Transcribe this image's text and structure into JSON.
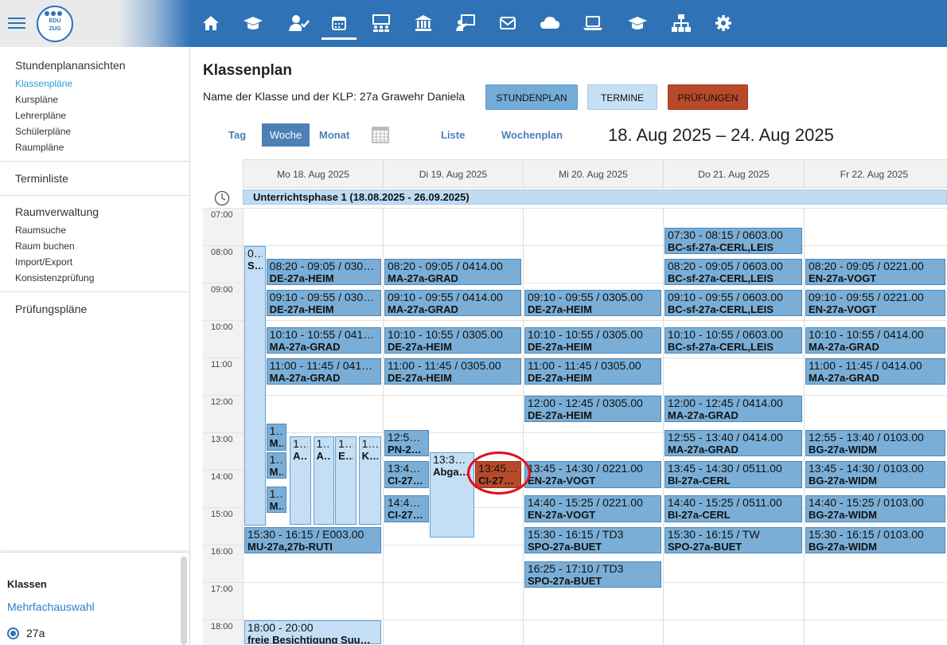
{
  "brand": {
    "logo_line1": "EDU",
    "logo_line2": "ZUG"
  },
  "nav": {
    "icons": [
      "home-icon",
      "graduation-cap-icon",
      "user-check-icon",
      "calendar-icon",
      "people-board-icon",
      "institution-icon",
      "teacher-board-icon",
      "envelope-icon",
      "cloud-icon",
      "laptop-icon",
      "graduation-cap-icon",
      "sitemap-icon",
      "gear-icon"
    ],
    "active": "calendar-icon"
  },
  "sidebar": {
    "section1_title": "Stundenplanansichten",
    "section1_items": [
      "Klassenpläne",
      "Kurspläne",
      "Lehrerpläne",
      "Schülerpläne",
      "Raumpläne"
    ],
    "section2_title": "Terminliste",
    "section3_title": "Raumverwaltung",
    "section3_items": [
      "Raumsuche",
      "Raum buchen",
      "Import/Export",
      "Konsistenzprüfung"
    ],
    "section4_title": "Prüfungspläne",
    "klassen_title": "Klassen",
    "mehrfach": "Mehrfachauswahl",
    "class_option": "27a"
  },
  "header": {
    "title": "Klassenplan",
    "class_line": "Name der Klasse und der KLP: 27a Grawehr Daniela",
    "btn_stundenplan": "STUNDENPLAN",
    "btn_termine": "TERMINE",
    "btn_pruefungen": "PRÜFUNGEN"
  },
  "views": {
    "tag": "Tag",
    "woche": "Woche",
    "monat": "Monat",
    "liste": "Liste",
    "wochenplan": "Wochenplan"
  },
  "date_range": "18. Aug 2025 – 24. Aug 2025",
  "days": [
    "Mo 18. Aug 2025",
    "Di 19. Aug 2025",
    "Mi 20. Aug 2025",
    "Do 21. Aug 2025",
    "Fr 22. Aug 2025"
  ],
  "phase": "Unterrichtsphase 1 (18.08.2025 - 26.09.2025)",
  "times": [
    "07:00",
    "08:00",
    "09:00",
    "10:00",
    "11:00",
    "12:00",
    "13:00",
    "14:00",
    "15:00",
    "16:00",
    "17:00",
    "18:00"
  ],
  "events": [
    {
      "day": 0,
      "start": "08:00",
      "end": "15:30",
      "sub": 0,
      "subw": 0.16,
      "style": "light",
      "t1": "0…",
      "t2": "Sch"
    },
    {
      "day": 0,
      "start": "08:20",
      "end": "09:05",
      "sub": 0.16,
      "subw": 0.84,
      "style": "",
      "t1": "08:20 - 09:05 / 030…",
      "t2": "DE-27a-HEIM"
    },
    {
      "day": 0,
      "start": "09:10",
      "end": "09:55",
      "sub": 0.16,
      "subw": 0.84,
      "style": "",
      "t1": "09:10 - 09:55 / 030…",
      "t2": "DE-27a-HEIM"
    },
    {
      "day": 0,
      "start": "10:10",
      "end": "10:55",
      "sub": 0.16,
      "subw": 0.84,
      "style": "",
      "t1": "10:10 - 10:55 / 041…",
      "t2": "MA-27a-GRAD"
    },
    {
      "day": 0,
      "start": "11:00",
      "end": "11:45",
      "sub": 0.16,
      "subw": 0.84,
      "style": "",
      "t1": "11:00 - 11:45 / 0414…",
      "t2": "MA-27a-GRAD"
    },
    {
      "day": 0,
      "start": "12:45",
      "end": "13:30",
      "sub": 0.16,
      "subw": 0.15,
      "style": "",
      "t1": "1…",
      "t2": "MU"
    },
    {
      "day": 0,
      "start": "13:30",
      "end": "14:15",
      "sub": 0.16,
      "subw": 0.15,
      "style": "",
      "t1": "1…",
      "t2": "MU"
    },
    {
      "day": 0,
      "start": "14:25",
      "end": "15:10",
      "sub": 0.16,
      "subw": 0.15,
      "style": "",
      "t1": "1…",
      "t2": "MU"
    },
    {
      "day": 0,
      "start": "13:05",
      "end": "15:30",
      "sub": 0.33,
      "subw": 0.16,
      "style": "light",
      "t1": "1…",
      "t2": "Abg"
    },
    {
      "day": 0,
      "start": "13:05",
      "end": "15:30",
      "sub": 0.5,
      "subw": 0.16,
      "style": "light",
      "t1": "1…",
      "t2": "Abg"
    },
    {
      "day": 0,
      "start": "13:05",
      "end": "15:30",
      "sub": 0.66,
      "subw": 0.16,
      "style": "light",
      "t1": "1…",
      "t2": "Ein"
    },
    {
      "day": 0,
      "start": "13:05",
      "end": "15:30",
      "sub": 0.83,
      "subw": 0.17,
      "style": "light",
      "t1": "1…",
      "t2": "Kor"
    },
    {
      "day": 0,
      "start": "15:30",
      "end": "16:15",
      "sub": 0,
      "subw": 1,
      "style": "",
      "t1": "15:30 - 16:15 / E003.00",
      "t2": "MU-27a,27b-RUTI"
    },
    {
      "day": 0,
      "start": "18:00",
      "end": "20:00",
      "sub": 0,
      "subw": 1,
      "style": "light",
      "t1": "18:00 - 20:00",
      "t2": "freie Besichtigung Suu…"
    },
    {
      "day": 1,
      "start": "08:20",
      "end": "09:05",
      "sub": 0,
      "subw": 1,
      "style": "",
      "t1": "08:20 - 09:05 / 0414.00",
      "t2": "MA-27a-GRAD"
    },
    {
      "day": 1,
      "start": "09:10",
      "end": "09:55",
      "sub": 0,
      "subw": 1,
      "style": "",
      "t1": "09:10 - 09:55 / 0414.00",
      "t2": "MA-27a-GRAD"
    },
    {
      "day": 1,
      "start": "10:10",
      "end": "10:55",
      "sub": 0,
      "subw": 1,
      "style": "",
      "t1": "10:10 - 10:55 / 0305.00",
      "t2": "DE-27a-HEIM"
    },
    {
      "day": 1,
      "start": "11:00",
      "end": "11:45",
      "sub": 0,
      "subw": 1,
      "style": "",
      "t1": "11:00 - 11:45 / 0305.00",
      "t2": "DE-27a-HEIM"
    },
    {
      "day": 1,
      "start": "12:55",
      "end": "13:40",
      "sub": 0,
      "subw": 0.33,
      "style": "",
      "t1": "12:55…",
      "t2": "PN-2…"
    },
    {
      "day": 1,
      "start": "13:45",
      "end": "14:30",
      "sub": 0,
      "subw": 0.33,
      "style": "",
      "t1": "13:45…",
      "t2": "CI-27…"
    },
    {
      "day": 1,
      "start": "14:40",
      "end": "15:25",
      "sub": 0,
      "subw": 0.33,
      "style": "",
      "t1": "14:40…",
      "t2": "CI-27…"
    },
    {
      "day": 1,
      "start": "13:30",
      "end": "15:50",
      "sub": 0.33,
      "subw": 0.33,
      "style": "light",
      "t1": "13:30…",
      "t2": "Abga…"
    },
    {
      "day": 1,
      "start": "13:45",
      "end": "14:30",
      "sub": 0.66,
      "subw": 0.34,
      "style": "red",
      "t1": "13:45…",
      "t2": "CI-27…"
    },
    {
      "day": 2,
      "start": "09:10",
      "end": "09:55",
      "sub": 0,
      "subw": 1,
      "style": "",
      "t1": "09:10 - 09:55 / 0305.00",
      "t2": "DE-27a-HEIM"
    },
    {
      "day": 2,
      "start": "10:10",
      "end": "10:55",
      "sub": 0,
      "subw": 1,
      "style": "",
      "t1": "10:10 - 10:55 / 0305.00",
      "t2": "DE-27a-HEIM"
    },
    {
      "day": 2,
      "start": "11:00",
      "end": "11:45",
      "sub": 0,
      "subw": 1,
      "style": "",
      "t1": "11:00 - 11:45 / 0305.00",
      "t2": "DE-27a-HEIM"
    },
    {
      "day": 2,
      "start": "12:00",
      "end": "12:45",
      "sub": 0,
      "subw": 1,
      "style": "",
      "t1": "12:00 - 12:45 / 0305.00",
      "t2": "DE-27a-HEIM"
    },
    {
      "day": 2,
      "start": "13:45",
      "end": "14:30",
      "sub": 0,
      "subw": 1,
      "style": "",
      "t1": "13:45 - 14:30 / 0221.00",
      "t2": "EN-27a-VOGT"
    },
    {
      "day": 2,
      "start": "14:40",
      "end": "15:25",
      "sub": 0,
      "subw": 1,
      "style": "",
      "t1": "14:40 - 15:25 / 0221.00",
      "t2": "EN-27a-VOGT"
    },
    {
      "day": 2,
      "start": "15:30",
      "end": "16:15",
      "sub": 0,
      "subw": 1,
      "style": "",
      "t1": "15:30 - 16:15 / TD3",
      "t2": "SPO-27a-BUET"
    },
    {
      "day": 2,
      "start": "16:25",
      "end": "17:10",
      "sub": 0,
      "subw": 1,
      "style": "",
      "t1": "16:25 - 17:10 / TD3",
      "t2": "SPO-27a-BUET"
    },
    {
      "day": 3,
      "start": "07:30",
      "end": "08:15",
      "sub": 0,
      "subw": 1,
      "style": "",
      "t1": "07:30 - 08:15 / 0603.00",
      "t2": "BC-sf-27a-CERL,LEIS"
    },
    {
      "day": 3,
      "start": "08:20",
      "end": "09:05",
      "sub": 0,
      "subw": 1,
      "style": "",
      "t1": "08:20 - 09:05 / 0603.00",
      "t2": "BC-sf-27a-CERL,LEIS"
    },
    {
      "day": 3,
      "start": "09:10",
      "end": "09:55",
      "sub": 0,
      "subw": 1,
      "style": "",
      "t1": "09:10 - 09:55 / 0603.00",
      "t2": "BC-sf-27a-CERL,LEIS"
    },
    {
      "day": 3,
      "start": "10:10",
      "end": "10:55",
      "sub": 0,
      "subw": 1,
      "style": "",
      "t1": "10:10 - 10:55 / 0603.00",
      "t2": "BC-sf-27a-CERL,LEIS"
    },
    {
      "day": 3,
      "start": "12:00",
      "end": "12:45",
      "sub": 0,
      "subw": 1,
      "style": "",
      "t1": "12:00 - 12:45 / 0414.00",
      "t2": "MA-27a-GRAD"
    },
    {
      "day": 3,
      "start": "12:55",
      "end": "13:40",
      "sub": 0,
      "subw": 1,
      "style": "",
      "t1": "12:55 - 13:40 / 0414.00",
      "t2": "MA-27a-GRAD"
    },
    {
      "day": 3,
      "start": "13:45",
      "end": "14:30",
      "sub": 0,
      "subw": 1,
      "style": "",
      "t1": "13:45 - 14:30 / 0511.00",
      "t2": "BI-27a-CERL"
    },
    {
      "day": 3,
      "start": "14:40",
      "end": "15:25",
      "sub": 0,
      "subw": 1,
      "style": "",
      "t1": "14:40 - 15:25 / 0511.00",
      "t2": "BI-27a-CERL"
    },
    {
      "day": 3,
      "start": "15:30",
      "end": "16:15",
      "sub": 0,
      "subw": 1,
      "style": "",
      "t1": "15:30 - 16:15 / TW",
      "t2": "SPO-27a-BUET"
    },
    {
      "day": 4,
      "start": "08:20",
      "end": "09:05",
      "sub": 0,
      "subw": 1,
      "style": "",
      "t1": "08:20 - 09:05 / 0221.00",
      "t2": "EN-27a-VOGT"
    },
    {
      "day": 4,
      "start": "09:10",
      "end": "09:55",
      "sub": 0,
      "subw": 1,
      "style": "",
      "t1": "09:10 - 09:55 / 0221.00",
      "t2": "EN-27a-VOGT"
    },
    {
      "day": 4,
      "start": "10:10",
      "end": "10:55",
      "sub": 0,
      "subw": 1,
      "style": "",
      "t1": "10:10 - 10:55 / 0414.00",
      "t2": "MA-27a-GRAD"
    },
    {
      "day": 4,
      "start": "11:00",
      "end": "11:45",
      "sub": 0,
      "subw": 1,
      "style": "",
      "t1": "11:00 - 11:45 / 0414.00",
      "t2": "MA-27a-GRAD"
    },
    {
      "day": 4,
      "start": "12:55",
      "end": "13:40",
      "sub": 0,
      "subw": 1,
      "style": "",
      "t1": "12:55 - 13:40 / 0103.00",
      "t2": "BG-27a-WIDM"
    },
    {
      "day": 4,
      "start": "13:45",
      "end": "14:30",
      "sub": 0,
      "subw": 1,
      "style": "",
      "t1": "13:45 - 14:30 / 0103.00",
      "t2": "BG-27a-WIDM"
    },
    {
      "day": 4,
      "start": "14:40",
      "end": "15:25",
      "sub": 0,
      "subw": 1,
      "style": "",
      "t1": "14:40 - 15:25 / 0103.00",
      "t2": "BG-27a-WIDM"
    },
    {
      "day": 4,
      "start": "15:30",
      "end": "16:15",
      "sub": 0,
      "subw": 1,
      "style": "",
      "t1": "15:30 - 16:15 / 0103.00",
      "t2": "BG-27a-WIDM"
    }
  ]
}
